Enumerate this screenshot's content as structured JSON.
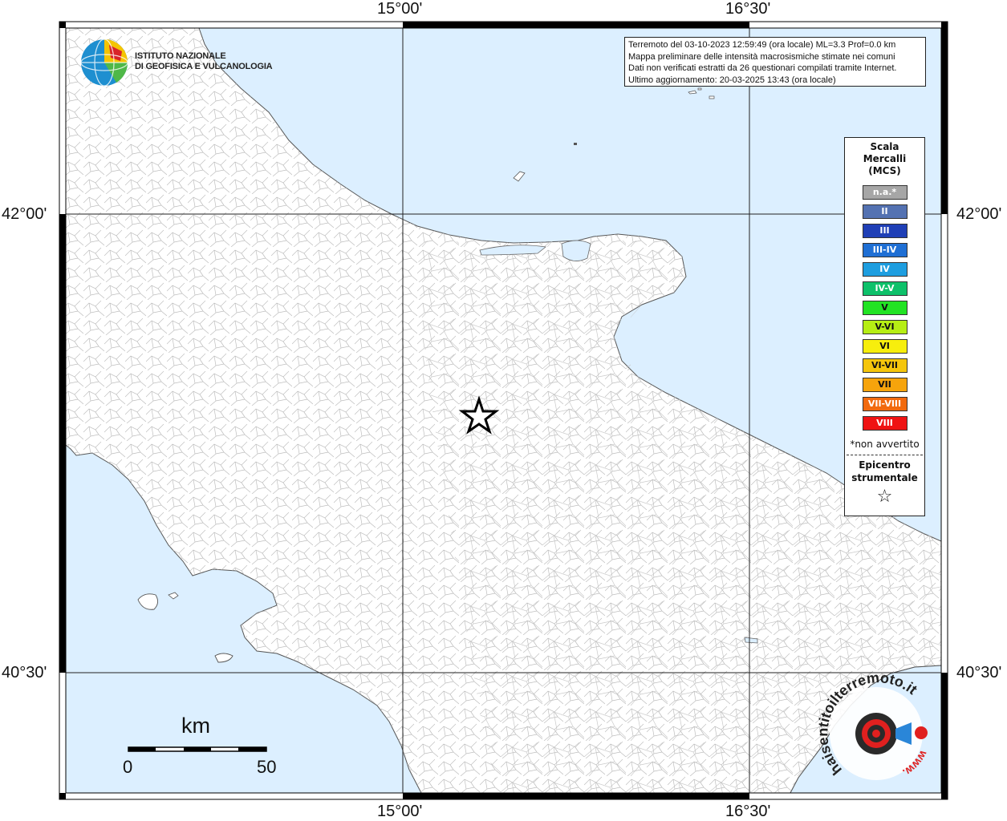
{
  "map": {
    "lon_labels": [
      "15°00'",
      "16°30'"
    ],
    "lat_labels": [
      "42°00'",
      "40°30'"
    ]
  },
  "info": {
    "line1": "Terremoto del 03-10-2023 12:59:49 (ora locale) ML=3.3 Prof=0.0 km",
    "line2": "Mappa preliminare delle intensità macrosismiche stimate nei comuni",
    "line3": "Dati non verificati estratti da 26 questionari compilati tramite Internet.",
    "line4": "Ultimo aggiornamento: 20-03-2025 13:43 (ora locale)"
  },
  "logo": {
    "line1": "ISTITUTO NAZIONALE",
    "line2": "DI GEOFISICA E VULCANOLOGIA"
  },
  "legend": {
    "title_line1": "Scala",
    "title_line2": "Mercalli",
    "title_line3": "(MCS)",
    "items": [
      {
        "label": "n.a.*",
        "color": "#a6a6a6"
      },
      {
        "label": "II",
        "color": "#5472b2"
      },
      {
        "label": "III",
        "color": "#1f3fb6"
      },
      {
        "label": "III-IV",
        "color": "#1f6fd4"
      },
      {
        "label": "IV",
        "color": "#1e9ee0"
      },
      {
        "label": "IV-V",
        "color": "#0ec16a"
      },
      {
        "label": "V",
        "color": "#22e324"
      },
      {
        "label": "V-VI",
        "color": "#b6ee14"
      },
      {
        "label": "VI",
        "color": "#f7ee0d"
      },
      {
        "label": "VI-VII",
        "color": "#f5c60c"
      },
      {
        "label": "VII",
        "color": "#f6a40c"
      },
      {
        "label": "VII-VIII",
        "color": "#f26a0e"
      },
      {
        "label": "VIII",
        "color": "#ef1313"
      }
    ],
    "note": "*non avvertito",
    "epicenter_line1": "Epicentro",
    "epicenter_line2": "strumentale",
    "epicenter_symbol": "☆"
  },
  "scale_bar": {
    "unit": "km",
    "start": "0",
    "end": "50"
  },
  "watermark": {
    "text": "haisentitoilterremoto.it",
    "url": "www."
  },
  "colors": {
    "sea": "#dcefff",
    "land": "#ffffff",
    "frame": "#000000"
  }
}
